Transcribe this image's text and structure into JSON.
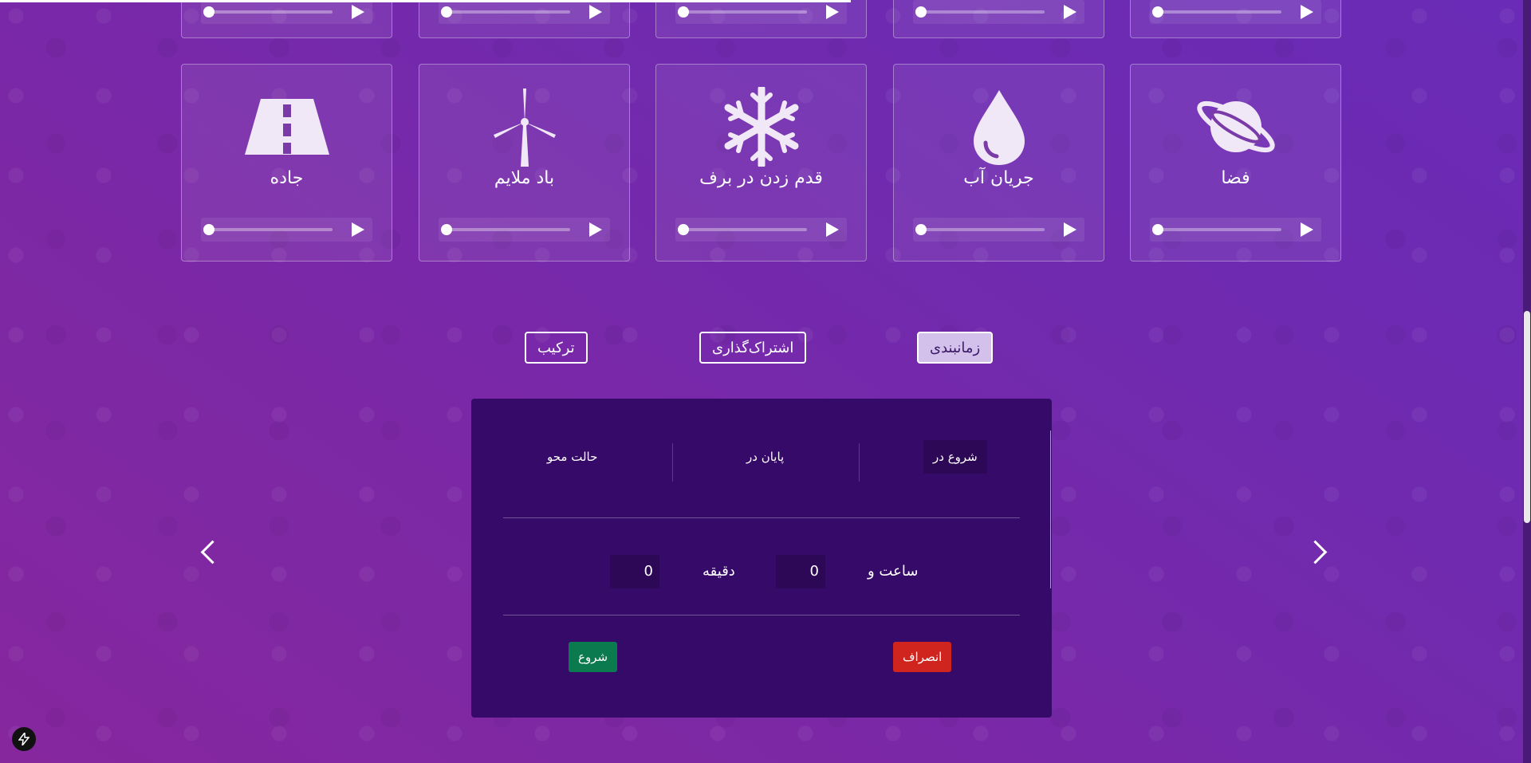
{
  "sounds_top": [
    {
      "id": "s1"
    },
    {
      "id": "s2"
    },
    {
      "id": "s3"
    },
    {
      "id": "s4"
    },
    {
      "id": "s5"
    }
  ],
  "sounds": [
    {
      "label": "جاده",
      "icon": "road-icon"
    },
    {
      "label": "باد ملایم",
      "icon": "wind-turbine-icon"
    },
    {
      "label": "قدم زدن در برف",
      "icon": "snowflake-icon"
    },
    {
      "label": "جریان آب",
      "icon": "water-drop-icon"
    },
    {
      "label": "فضا",
      "icon": "planet-icon"
    }
  ],
  "tabs": {
    "mix": "ترکیب",
    "share": "اشتراک‌گذاری",
    "timer": "زمانبندی"
  },
  "timer": {
    "col_start": "شروع در",
    "col_end": "پایان در",
    "col_fade": "حالت محو",
    "hours_value": "0",
    "hours_label": "ساعت و",
    "minutes_value": "0",
    "minutes_label": "دقیقه",
    "cancel": "انصراف",
    "start": "شروع"
  },
  "colors": {
    "panel": "#360a68",
    "cancel": "#d0241e",
    "start": "#0c7a4f",
    "active_tab": "#d3c1ec"
  }
}
